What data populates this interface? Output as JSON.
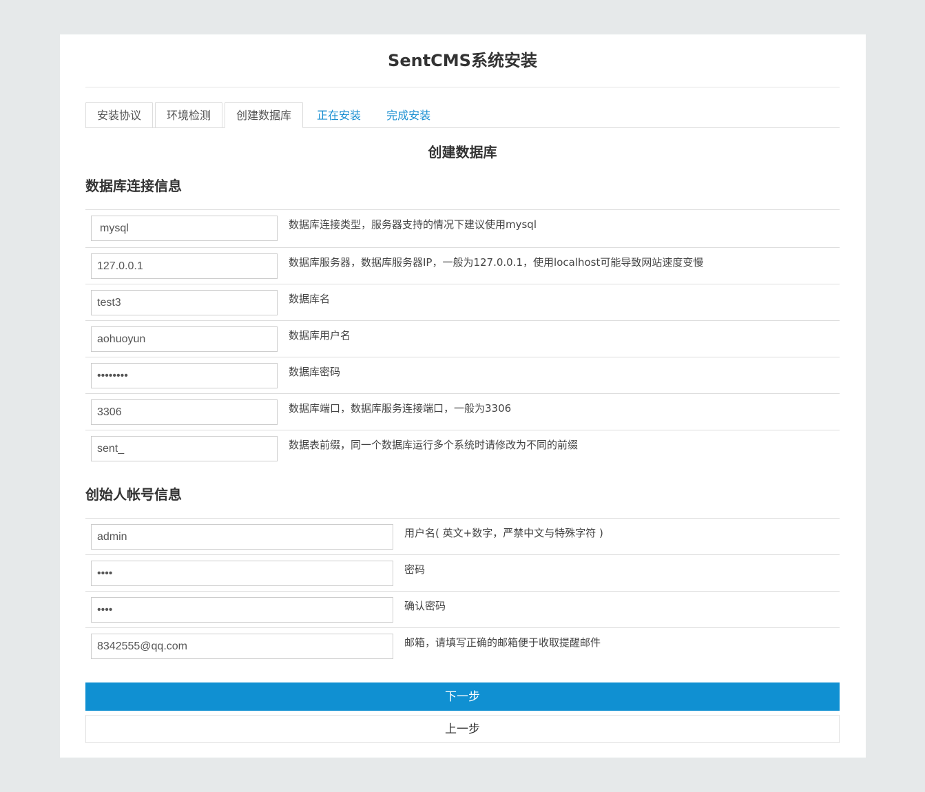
{
  "app": {
    "title": "SentCMS系统安装"
  },
  "tabs": [
    {
      "label": "安装协议",
      "state": "done"
    },
    {
      "label": "环境检测",
      "state": "done"
    },
    {
      "label": "创建数据库",
      "state": "active"
    },
    {
      "label": "正在安装",
      "state": "pending"
    },
    {
      "label": "完成安装",
      "state": "pending"
    }
  ],
  "step_heading": "创建数据库",
  "db_section": {
    "heading": "数据库连接信息",
    "rows": [
      {
        "value": "mysql",
        "help": "数据库连接类型，服务器支持的情况下建议使用mysql"
      },
      {
        "value": "127.0.0.1",
        "help": "数据库服务器，数据库服务器IP，一般为127.0.0.1，使用localhost可能导致网站速度变慢"
      },
      {
        "value": "test3",
        "help": "数据库名"
      },
      {
        "value": "aohuoyun",
        "help": "数据库用户名"
      },
      {
        "value": "••••••••",
        "help": "数据库密码"
      },
      {
        "value": "3306",
        "help": "数据库端口，数据库服务连接端口，一般为3306"
      },
      {
        "value": "sent_",
        "help": "数据表前缀，同一个数据库运行多个系统时请修改为不同的前缀"
      }
    ]
  },
  "admin_section": {
    "heading": "创始人帐号信息",
    "rows": [
      {
        "value": "admin",
        "help": "用户名( 英文+数字，严禁中文与特殊字符 )"
      },
      {
        "value": "••••",
        "help": "密码"
      },
      {
        "value": "••••",
        "help": "确认密码"
      },
      {
        "value": "8342555@qq.com",
        "help": "邮箱，请填写正确的邮箱便于收取提醒邮件"
      }
    ]
  },
  "buttons": {
    "next": "下一步",
    "prev": "上一步"
  },
  "colors": {
    "accent": "#1090d2",
    "pending_tab": "#1a8fd1",
    "background": "#e6e9ea"
  }
}
